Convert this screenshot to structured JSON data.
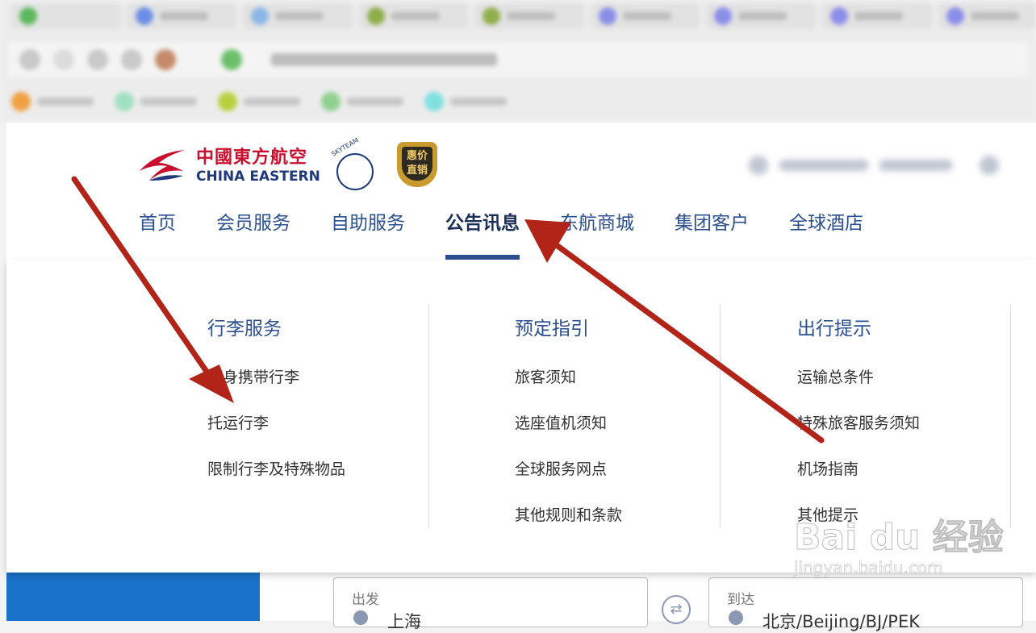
{
  "brand": {
    "name_cn": "中國東方航空",
    "name_en": "CHINA EASTERN",
    "alliance": "SKYTEAM",
    "badge_text": "惠价直销",
    "primary_color": "#c8102e",
    "nav_color": "#2b4f90"
  },
  "nav": {
    "items": [
      {
        "label": "首页"
      },
      {
        "label": "会员服务"
      },
      {
        "label": "自助服务"
      },
      {
        "label": "公告讯息",
        "active": true
      },
      {
        "label": "东航商城"
      },
      {
        "label": "集团客户"
      },
      {
        "label": "全球酒店"
      }
    ]
  },
  "dropdown": {
    "columns": [
      {
        "title": "行李服务",
        "links": [
          "随身携带行李",
          "托运行李",
          "限制行李及特殊物品"
        ]
      },
      {
        "title": "预定指引",
        "links": [
          "旅客须知",
          "选座值机须知",
          "全球服务网点",
          "其他规则和条款"
        ]
      },
      {
        "title": "出行提示",
        "links": [
          "运输总条件",
          "特殊旅客服务须知",
          "机场指南",
          "其他提示"
        ]
      }
    ]
  },
  "search": {
    "depart_label": "出发",
    "depart_value": "上海",
    "arrive_label": "到达",
    "arrive_value": "北京/Beijing/BJ/PEK",
    "swap_icon": "swap-arrows-icon"
  },
  "watermark": {
    "brand": "Bai du 经验",
    "url": "jingyan.baidu.com"
  },
  "annotation": {
    "arrow_color": "#b22418"
  }
}
